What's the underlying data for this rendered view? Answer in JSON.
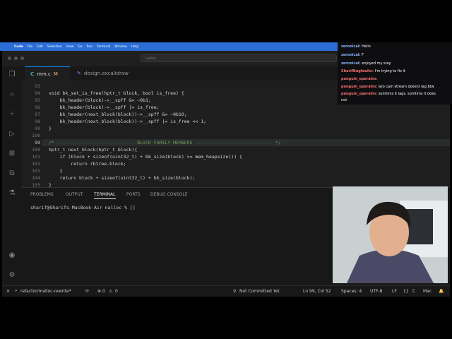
{
  "menubar": {
    "app": "Code",
    "items": [
      "File",
      "Edit",
      "Selection",
      "View",
      "Go",
      "Run",
      "Terminal",
      "Window",
      "Help"
    ]
  },
  "search": {
    "placeholder": "nalloc"
  },
  "tabs": [
    {
      "label": "mm.c",
      "modified": "M"
    },
    {
      "label": "design.excalidraw"
    }
  ],
  "editor": {
    "lines": [
      {
        "n": "93",
        "code": ""
      },
      {
        "n": "94",
        "code": "void bk_set_is_free(hptr_t block, bool is_free) {"
      },
      {
        "n": "95",
        "code": "    bk_header(block)->__spff &= ~0b1;"
      },
      {
        "n": "96",
        "code": "    bk_header(block)->__spff |= is_free;"
      },
      {
        "n": "97",
        "code": "    bk_header(next_block(block))->__spff &= ~0b10;"
      },
      {
        "n": "98",
        "code": "    bk_header(next_block(block))->__spff |= is_free << 1;"
      },
      {
        "n": "99",
        "code": "}"
      },
      {
        "n": "100",
        "code": ""
      },
      {
        "n": "99",
        "code": "/* ---------------------------- BLOCK FAMILY MEMBERS ---------------------------- */"
      },
      {
        "n": "100",
        "code": "hptr_t next_block(hptr_t block){"
      },
      {
        "n": "101",
        "code": "    if (block + sizeof(uint32_t) + bk_size(block) >= mem_heapsize()) {"
      },
      {
        "n": "102",
        "code": "        return rbtree.block;"
      },
      {
        "n": "103",
        "code": "    }"
      },
      {
        "n": "104",
        "code": "    return block + sizeof(uint32_t) + bk_size(block);"
      },
      {
        "n": "105",
        "code": "}"
      }
    ]
  },
  "panel": {
    "tabs": [
      "PROBLEMS",
      "OUTPUT",
      "TERMINAL",
      "PORTS",
      "DEBUG CONSOLE"
    ],
    "prompt": "sharif@Sharifs-MacBook-Air nalloc % []"
  },
  "statusbar": {
    "branch": "refactor/malloc-rewrite*",
    "errors": "0",
    "warnings": "0",
    "commit": "Not Committed Yet",
    "position": "Ln 99, Col 52",
    "spaces": "Spaces: 4",
    "encoding": "UTF-8",
    "eol": "LF",
    "lang": "C",
    "platform": "Mac"
  },
  "chat": [
    {
      "user": "zeronical:",
      "msg": "Hello"
    },
    {
      "user": "zeronical:",
      "msg": "F"
    },
    {
      "user": "zeronical:",
      "msg": "enjoyed my stay"
    },
    {
      "user": "SharifBugfaults:",
      "msg": "I'm trying to fix it"
    },
    {
      "user": "penguin_operatio:",
      "msg": ""
    },
    {
      "user": "penguin_operatio:",
      "msg": "w/o cam stream doesnt lag btw"
    },
    {
      "user": "penguin_operatio:",
      "msg": "somtims it lags. somtims it does"
    },
    {
      "user": "",
      "msg": "not"
    }
  ],
  "colors": {
    "accent": "#0a84ff",
    "menubar": "#2b6fd6",
    "editor_bg": "#1e1e1e"
  }
}
